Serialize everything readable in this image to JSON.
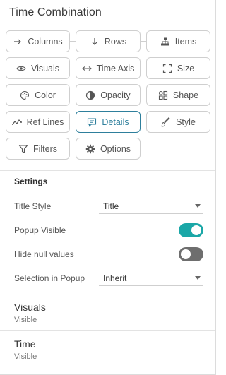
{
  "panel": {
    "title": "Time Combination"
  },
  "buttons": [
    {
      "label": "Columns",
      "icon": "arrow-right-icon"
    },
    {
      "label": "Rows",
      "icon": "arrow-down-icon"
    },
    {
      "label": "Items",
      "icon": "hierarchy-icon"
    },
    {
      "label": "Visuals",
      "icon": "eye-icon"
    },
    {
      "label": "Time Axis",
      "icon": "arrows-horizontal-icon"
    },
    {
      "label": "Size",
      "icon": "resize-corners-icon"
    },
    {
      "label": "Color",
      "icon": "palette-icon"
    },
    {
      "label": "Opacity",
      "icon": "opacity-icon"
    },
    {
      "label": "Shape",
      "icon": "shapes-icon"
    },
    {
      "label": "Ref Lines",
      "icon": "line-chart-icon"
    },
    {
      "label": "Details",
      "icon": "message-icon"
    },
    {
      "label": "Style",
      "icon": "brush-icon"
    },
    {
      "label": "Filters",
      "icon": "funnel-icon"
    },
    {
      "label": "Options",
      "icon": "gear-icon"
    }
  ],
  "settings": {
    "heading": "Settings",
    "title_style": {
      "label": "Title Style",
      "value": "Title"
    },
    "popup_visible": {
      "label": "Popup Visible",
      "on": true
    },
    "hide_null": {
      "label": "Hide null values",
      "on": false
    },
    "selection_popup": {
      "label": "Selection in Popup",
      "value": "Inherit"
    }
  },
  "sections": [
    {
      "title": "Visuals",
      "subtitle": "Visible"
    },
    {
      "title": "Time",
      "subtitle": "Visible"
    }
  ],
  "colors": {
    "accent": "#2e7f9c",
    "toggle_on": "#1aa7a7",
    "toggle_off": "#6e6e6e"
  }
}
